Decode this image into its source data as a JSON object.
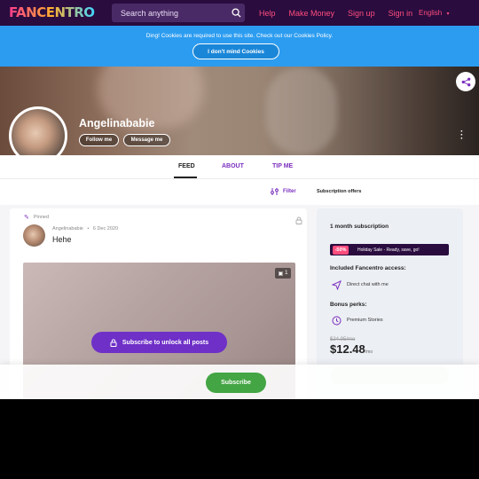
{
  "header": {
    "logo_text": "FANCENTRO",
    "search_placeholder": "Search anything",
    "nav": [
      "Help",
      "Make Money",
      "Sign up",
      "Sign in"
    ],
    "language": "English"
  },
  "cookie_banner": {
    "text": "Ding! Cookies are required to use this site. Check out our Cookies Policy.",
    "button_label": "I don't mind Cookies"
  },
  "profile": {
    "name": "Angelinababie",
    "follow_label": "Follow me",
    "message_label": "Message me"
  },
  "tabs": [
    "FEED",
    "ABOUT",
    "TIP ME"
  ],
  "feed": {
    "filter_label": "Filter",
    "subscription_offers_label": "Subscription offers"
  },
  "post": {
    "pinned_label": "Pinned",
    "author": "Angelinababie",
    "date": "6 Dec 2020",
    "text": "Hehe",
    "media_count": "1",
    "unlock_label": "Subscribe to unlock all posts"
  },
  "subscription": {
    "title": "1 month subscription",
    "sale_badge": "-50%",
    "sale_text": "Holiday Sale - Ready, save, go!",
    "included_title": "Included Fancentro access:",
    "included_item": "Direct chat with me",
    "bonus_title": "Bonus perks:",
    "bonus_item": "Premium Stories",
    "old_price": "$24.95/mo",
    "new_price": "$12.48",
    "per": "/mo"
  },
  "sticky": {
    "subscribe_label": "Subscribe"
  },
  "colors": {
    "nav_bg": "#2a0c3f",
    "accent_pink": "#ff4d7d",
    "cookie_blue": "#2c9cf0",
    "purple": "#6f30c8",
    "green": "#43a543"
  }
}
